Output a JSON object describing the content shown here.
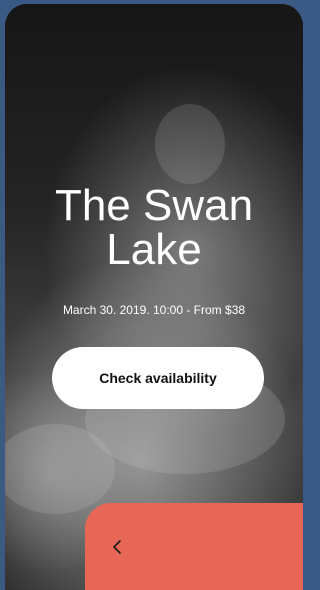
{
  "event": {
    "title": "The Swan Lake",
    "details": "March 30. 2019. 10:00 - From $38"
  },
  "actions": {
    "check_availability_label": "Check availability"
  },
  "navigation": {
    "back_icon": "chevron-left-icon"
  },
  "colors": {
    "accent": "#e86656",
    "button_background": "#ffffff",
    "title_text": "#ffffff"
  }
}
